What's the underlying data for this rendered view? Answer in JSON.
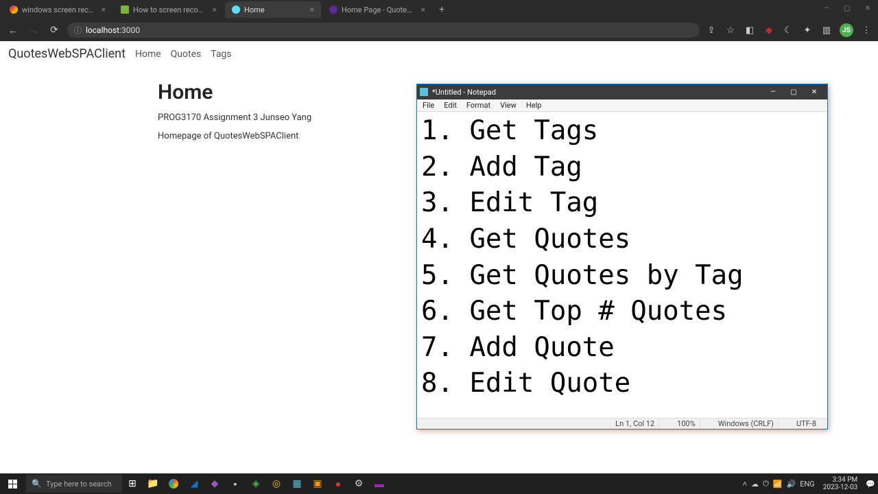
{
  "browser": {
    "tabs": [
      {
        "title": "windows screen recording - Go..."
      },
      {
        "title": "How to screen record in Windo..."
      },
      {
        "title": "Home"
      },
      {
        "title": "Home Page - QuotesWebAPI"
      }
    ],
    "url_host": "localhost",
    "url_port": ":3000",
    "avatar_initials": "JS",
    "window_controls": {
      "min": "—",
      "max": "▢",
      "close": "✕"
    }
  },
  "page": {
    "brand": "QuotesWebSPAClient",
    "nav": {
      "home": "Home",
      "quotes": "Quotes",
      "tags": "Tags"
    },
    "heading": "Home",
    "line1": "PROG3170 Assignment 3 Junseo Yang",
    "line2": "Homepage of QuotesWebSPAClient"
  },
  "notepad": {
    "title": "*Untitled - Notepad",
    "menu": {
      "file": "File",
      "edit": "Edit",
      "format": "Format",
      "view": "View",
      "help": "Help"
    },
    "content": "1. Get Tags\n2. Add Tag\n3. Edit Tag\n4. Get Quotes\n5. Get Quotes by Tag\n6. Get Top # Quotes\n7. Add Quote\n8. Edit Quote",
    "status": {
      "pos": "Ln 1, Col 12",
      "zoom": "100%",
      "crlf": "Windows (CRLF)",
      "enc": "UTF-8"
    },
    "window_controls": {
      "min": "—",
      "max": "▢",
      "close": "✕"
    }
  },
  "taskbar": {
    "search_placeholder": "Type here to search",
    "tray": {
      "lang": "ENG",
      "time": "3:34 PM",
      "date": "2023-12-03"
    }
  }
}
